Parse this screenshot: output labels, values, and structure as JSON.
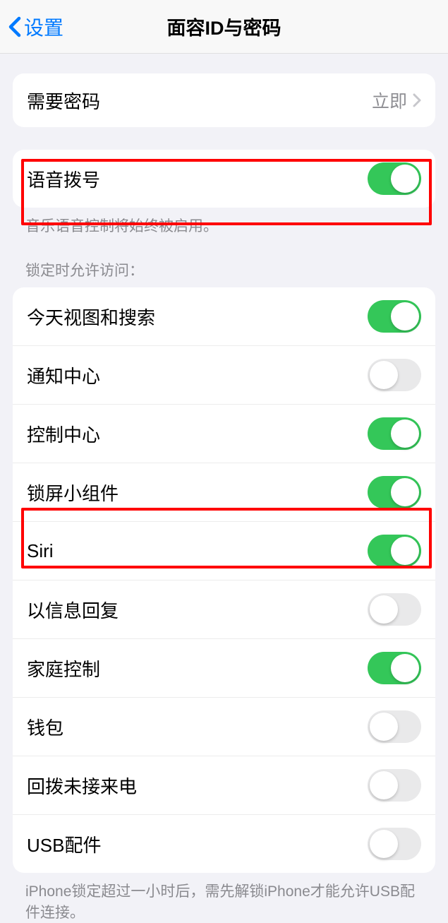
{
  "nav": {
    "back_label": "设置",
    "title": "面容ID与密码"
  },
  "require_passcode": {
    "label": "需要密码",
    "value": "立即"
  },
  "voice_dial": {
    "label": "语音拨号",
    "on": true,
    "footer": "音乐语音控制将始终被启用。"
  },
  "lock_section_header": "锁定时允许访问：",
  "lock_items": [
    {
      "label": "今天视图和搜索",
      "on": true
    },
    {
      "label": "通知中心",
      "on": false
    },
    {
      "label": "控制中心",
      "on": true
    },
    {
      "label": "锁屏小组件",
      "on": true
    },
    {
      "label": "Siri",
      "on": true
    },
    {
      "label": "以信息回复",
      "on": false
    },
    {
      "label": "家庭控制",
      "on": true
    },
    {
      "label": "钱包",
      "on": false
    },
    {
      "label": "回拨未接来电",
      "on": false
    },
    {
      "label": "USB配件",
      "on": false
    }
  ],
  "lock_footer": "iPhone锁定超过一小时后，需先解锁iPhone才能允许USB配件连接。"
}
